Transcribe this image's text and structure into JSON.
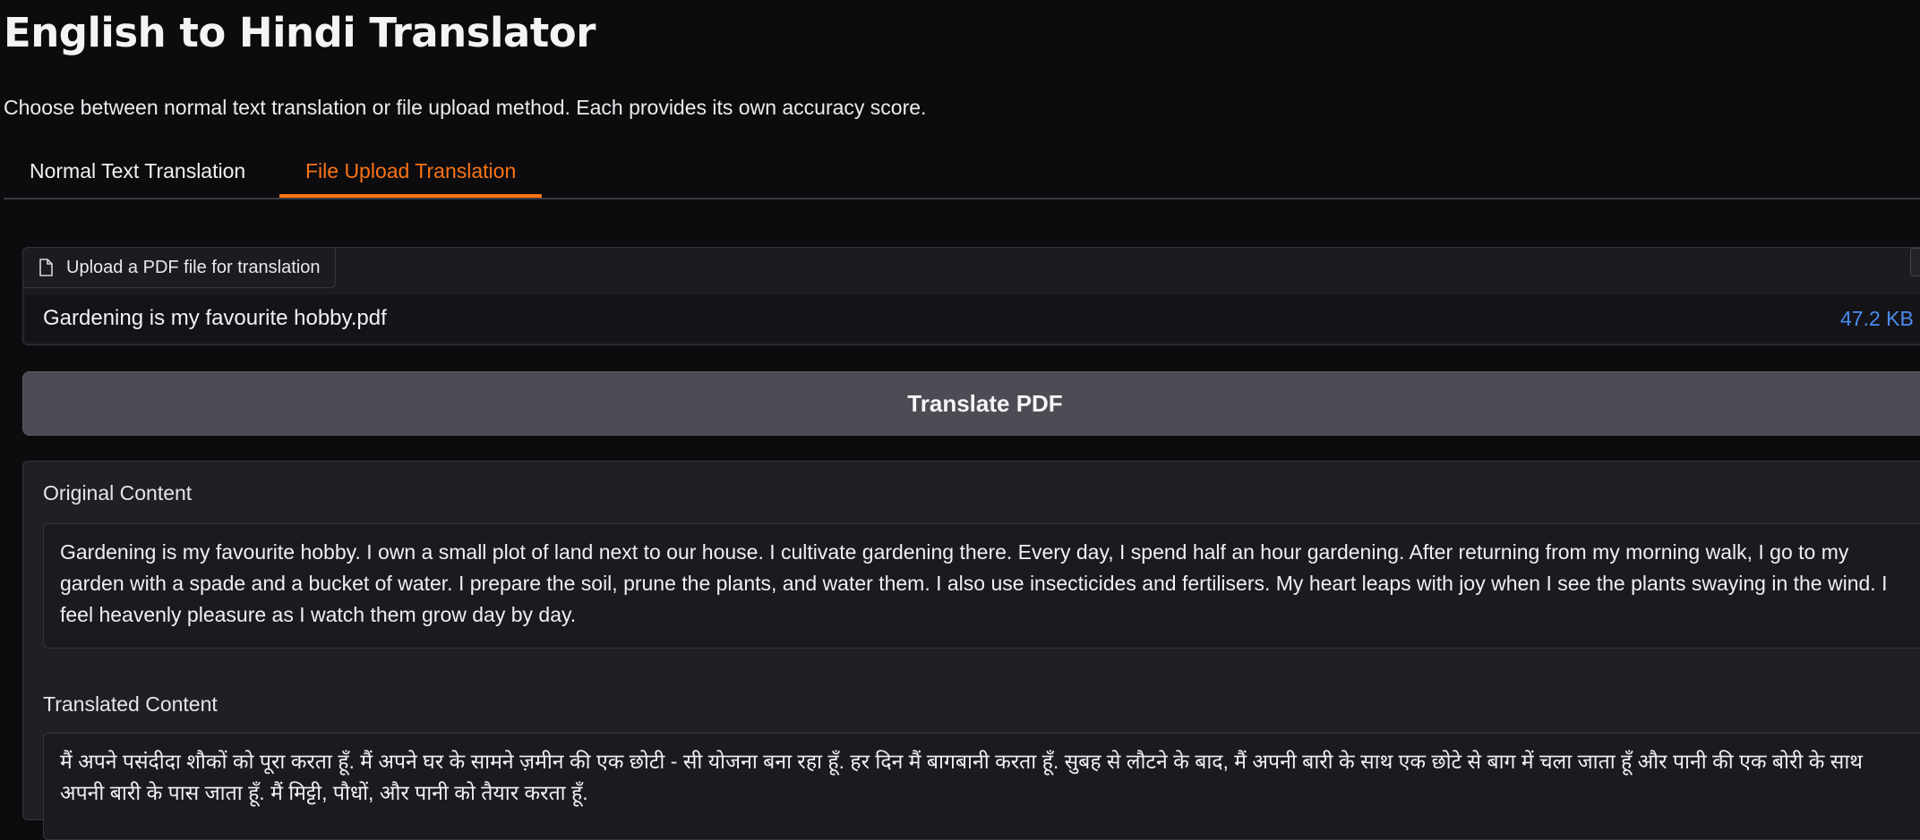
{
  "app": {
    "title": "English to Hindi Translator",
    "description": "Choose between normal text translation or file upload method. Each provides its own accuracy score."
  },
  "tabs": [
    {
      "label": "Normal Text Translation",
      "active": false
    },
    {
      "label": "File Upload Translation",
      "active": true
    }
  ],
  "upload": {
    "label": "Upload a PDF file for translation",
    "icon": "file-icon",
    "file_name": "Gardening is my favourite hobby.pdf",
    "file_size": "47.2 KB ↓"
  },
  "actions": {
    "translate_label": "Translate PDF"
  },
  "output": {
    "original_label": "Original Content",
    "original_text": "Gardening is my favourite hobby. I own a small plot of land next to our house. I cultivate gardening there. Every day, I spend half an hour gardening. After returning from my morning walk, I go to my garden with a spade and a bucket of water. I prepare the soil, prune the plants, and water them. I also use insecticides and fertilisers. My heart leaps with joy when I see the plants swaying in the wind. I feel heavenly pleasure as I watch them grow day by day.",
    "translated_label": "Translated Content",
    "translated_text": "मैं अपने पसंदीदा शौकों को पूरा करता हूँ. मैं अपने घर के सामने ज़मीन की एक छोटी - सी योजना बना रहा हूँ. हर दिन मैं बागबानी करता हूँ. सुबह से लौटने के बाद, मैं अपनी बारी के साथ एक छोटे से बाग में चला जाता हूँ और पानी की एक बोरी के साथ अपनी बारी के पास जाता हूँ. मैं मिट्टी, पौधों, और पानी को तैयार करता हूँ."
  },
  "colors": {
    "background": "#0c0c0f",
    "accent": "#f97316",
    "link": "#4a8cf0",
    "button": "#4c4c55"
  }
}
